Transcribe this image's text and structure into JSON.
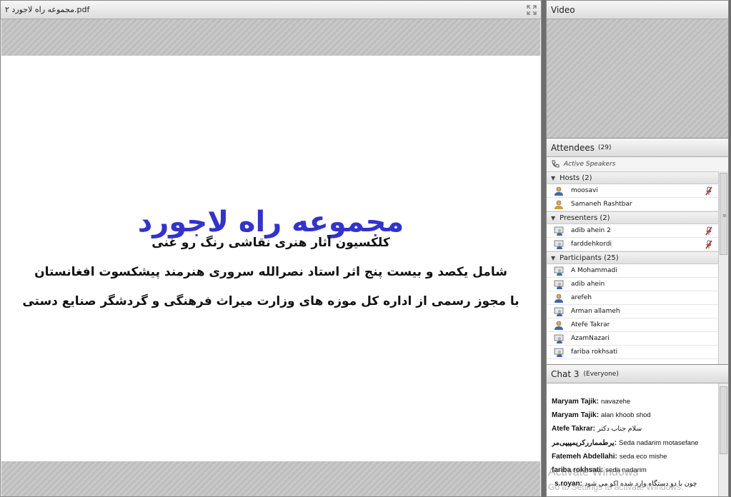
{
  "share": {
    "filename": "مجموعه راه لاجورد ۲.pdf",
    "slide": {
      "title": "مجموعه راه لاجورد",
      "line1": "کلکسیون آثار هنری نقاشی رنگ رو غنی",
      "line2": "شامل یکصد و بیست پنج اثر استاد نصرالله سروری هنرمند پیشکسوت افغانستان",
      "line3": "با مجوز رسمی از اداره کل موزه های وزارت میراث فرهنگی و گردشگر صنایع دستی"
    }
  },
  "video": {
    "title": "Video"
  },
  "attendees": {
    "title": "Attendees",
    "count": "(29)",
    "active_speakers": "Active Speakers",
    "groups": {
      "hosts": {
        "label": "Hosts (2)",
        "members": [
          "moosavi",
          "Samaneh Rashtbar"
        ]
      },
      "presenters": {
        "label": "Presenters (2)",
        "members": [
          "adib ahein 2",
          "farddehkordi"
        ]
      },
      "participants": {
        "label": "Participants (25)",
        "members": [
          "A Mohammadi",
          "adib ahein",
          "arefeh",
          "Arman allameh",
          "Atefe  Takrar",
          "AzamNazari",
          "fariba rokhsati"
        ]
      }
    }
  },
  "chat": {
    "title": "Chat 3",
    "scope": "(Everyone)",
    "messages": [
      {
        "sender": "Maryam Tajik:",
        "text": "navazehe"
      },
      {
        "sender": "Maryam Tajik:",
        "text": "alan khoob shod"
      },
      {
        "sender": "Atefe  Takrar:",
        "text": "سلام جناب دکتر"
      },
      {
        "sender": "یرطمماررکریمپیپی‌مر:",
        "text": "Seda nadarim motasefane"
      },
      {
        "sender": "Fatemeh Abdellahi:",
        "text": "seda eco mishe"
      },
      {
        "sender": "fariba rokhsati:",
        "text": "seda nadarim"
      },
      {
        "sender": "s.royan:",
        "text": "چون با دو دستگاه وارد شده اکو می شود"
      }
    ]
  },
  "watermark": {
    "line1": "Activate Windows",
    "line2": "Go to Settings to activate Windows."
  },
  "colors": {
    "slide_title": "#3333cc",
    "mic_red": "#cc2222"
  }
}
